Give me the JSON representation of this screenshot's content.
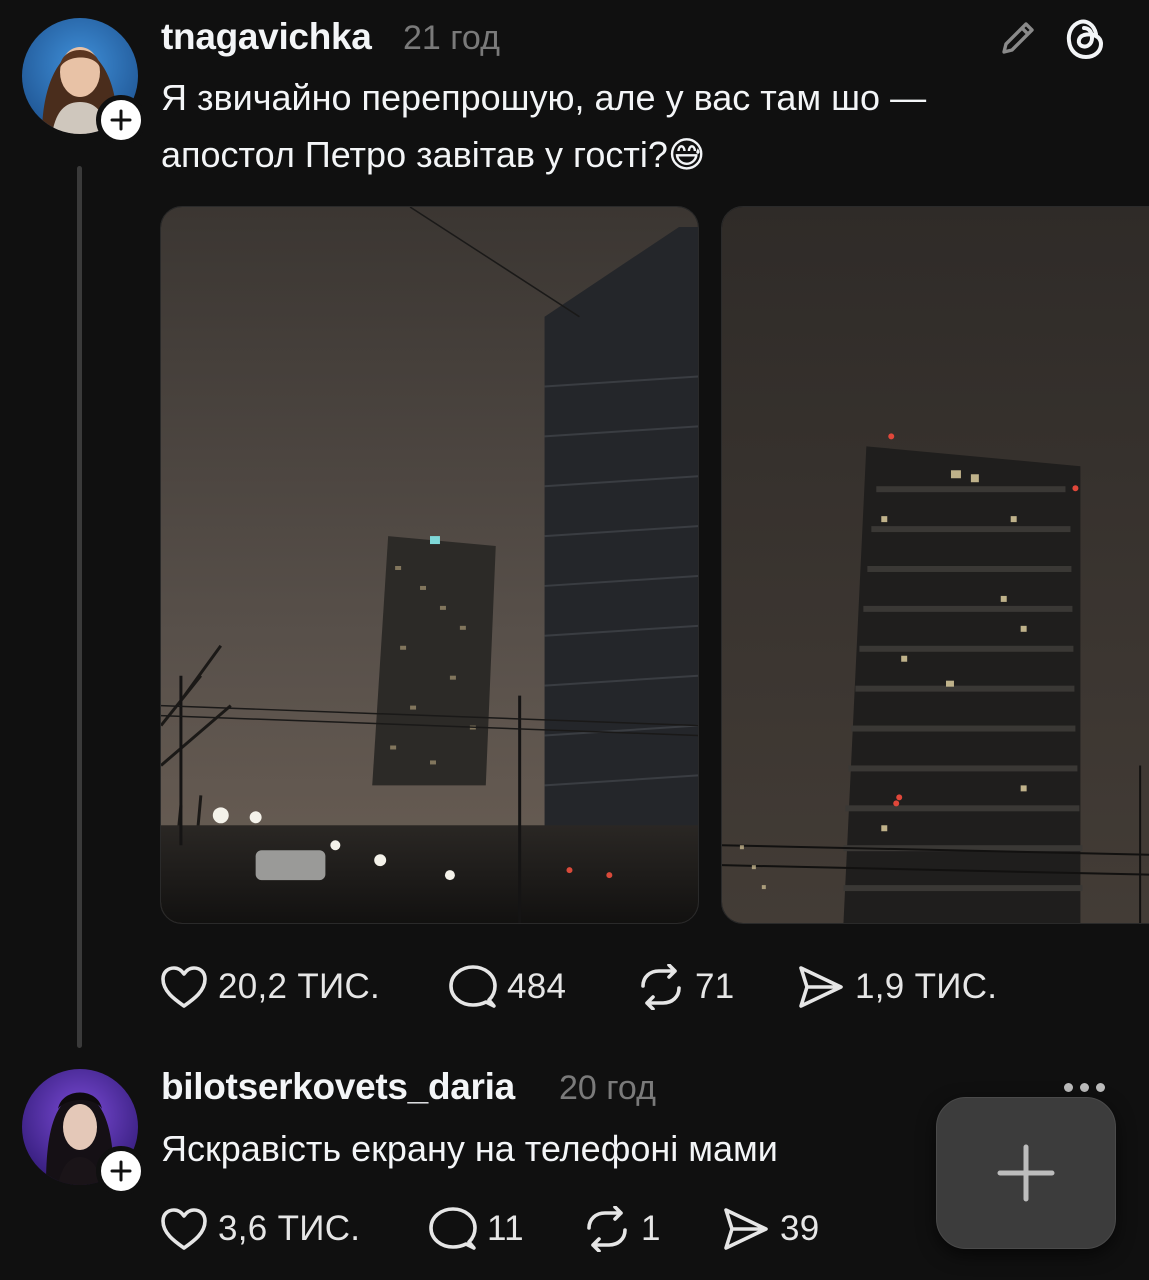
{
  "posts": [
    {
      "username": "tnagavichka",
      "time": "21 год",
      "text_lines": [
        "Я звичайно перепрошую, але у вас там шо —",
        "апостол Петро завітав у гості?😅"
      ],
      "media": [
        {
          "icon": "night-city-tower-photo"
        },
        {
          "icon": "foggy-tower-photo"
        }
      ],
      "actions": {
        "likes": "20,2 ТИС.",
        "replies": "484",
        "reposts": "71",
        "shares": "1,9 ТИС."
      }
    },
    {
      "username": "bilotserkovets_daria",
      "time": "20 год",
      "text_lines": [
        "Яскравість екрану на телефоні мами"
      ],
      "actions": {
        "likes": "3,6 ТИС.",
        "replies": "11",
        "reposts": "1",
        "shares": "39"
      }
    }
  ],
  "icons": {
    "edit": "pencil-icon",
    "app_logo": "threads-logo-icon",
    "like": "heart-icon",
    "reply": "comment-icon",
    "repost": "repost-icon",
    "share": "send-icon",
    "more": "more-dots-icon",
    "compose": "plus-icon"
  },
  "colors": {
    "background": "#101010",
    "text": "#f3f5f7",
    "muted": "#7a7a7a",
    "fab": "#3c3c3c"
  }
}
